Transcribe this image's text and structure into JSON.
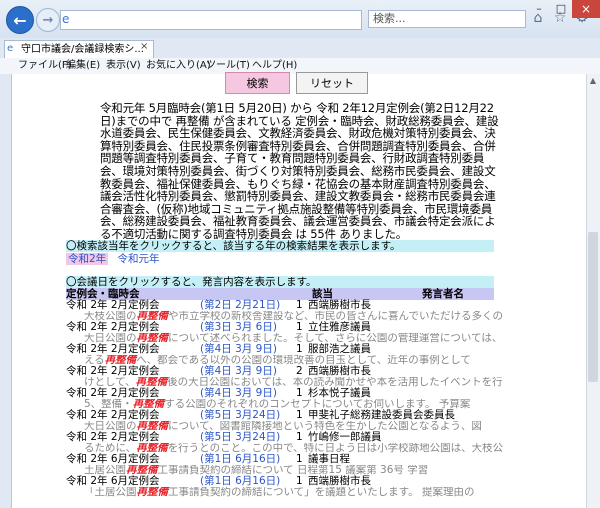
{
  "browser": {
    "address": "",
    "search_placeholder": "検索...",
    "tab_title": "守口市議会/会議録検索シ...",
    "menu": [
      "ファイル(F)",
      "編集(E)",
      "表示(V)",
      "お気に入り(A)",
      "ツール(T)",
      "ヘルプ(H)"
    ]
  },
  "toolbar": {
    "search_label": "検索",
    "reset_label": "リセット"
  },
  "summary": "令和元年 5月臨時会(第1日 5月20日) から 令和 2年12月定例会(第2日12月22日)までの中で 再整備 が含まれている 定例会・臨時会、財政総務委員会、建設水道委員会、民生保健委員会、文教経済委員会、財政危機対策特別委員会、決算特別委員会、住民投票条例審査特別委員会、合併問題調査特別委員会、合併問題等調査特別委員会、子育て・教育問題特別委員会、行財政調査特別委員会、環境対策特別委員会、街づくり対策特別委員会、総務市民委員会、建設文教委員会、福祉保健委員会、もりぐち緑・花協会の基本財産調査特別委員会、議会活性化特別委員会、懲罰特別委員会、建設文教委員会・総務市民委員会連合審査会、(仮称)地域コミュニティ拠点施設整備等特別委員会、市民環境委員会、総務建設委員会、福祉教育委員会、議会運営委員会、市議会特定会派による不適切活動に関する調査特別委員会 は 55件 ありました。",
  "hint_year": "〇検索該当年をクリックすると、該当する年の検索結果を表示します。",
  "years": {
    "selected": "令和2年",
    "other": "令和元年"
  },
  "hint_meeting": "〇会議日をクリックすると、発言内容を表示します。",
  "header": {
    "session": "定例会・臨時会",
    "date": "該当",
    "speaker": "発言者名"
  },
  "rows": [
    {
      "session": "令和 2年 2月定例会",
      "date": "(第2日 2月21日)",
      "num": "1",
      "speaker": "西端勝樹市長",
      "snip_pre": "大枝公園の",
      "snip_hl": "再整備",
      "snip_post": "や市立学校の新校舎建設など、市民の皆さんに喜んでいただける多くの"
    },
    {
      "session": "令和 2年 2月定例会",
      "date": "(第3日 3月 6日)",
      "num": "1",
      "speaker": "立住雅彦議員",
      "snip_pre": "大日公園の",
      "snip_hl": "再整備",
      "snip_post": "について述べられました。そして、さらに公園の管理運営については、"
    },
    {
      "session": "令和 2年 2月定例会",
      "date": "(第4日 3月 9日)",
      "num": "1",
      "speaker": "服部浩之議員",
      "snip_pre": "える",
      "snip_hl": "再整備",
      "snip_post": "へ、都会である以外の公園の環境改善の目玉として、近年の事例として"
    },
    {
      "session": "令和 2年 2月定例会",
      "date": "(第4日 3月 9日)",
      "num": "2",
      "speaker": "西端勝樹市長",
      "snip_pre": "けとして、",
      "snip_hl": "再整備",
      "snip_post": "後の大日公園においては、本の読み聞かせや本を活用したイベントを行"
    },
    {
      "session": "令和 2年 2月定例会",
      "date": "(第4日 3月 9日)",
      "num": "1",
      "speaker": "杉本悦子議員",
      "snip_pre": "5、整備・",
      "snip_hl": "再整備",
      "snip_post": "する公園のそれぞれのコンセプトについてお伺いします。 予算案"
    },
    {
      "session": "令和 2年 2月定例会",
      "date": "(第5日 3月24日)",
      "num": "1",
      "speaker": "甲斐礼子総務建設委員会委員長",
      "snip_pre": "大日公園の",
      "snip_hl": "再整備",
      "snip_post": "について、図書館隣接地という特色を生かした公園となるよう、図"
    },
    {
      "session": "令和 2年 2月定例会",
      "date": "(第5日 3月24日)",
      "num": "1",
      "speaker": "竹嶋修一郎議員",
      "snip_pre": "るために、",
      "snip_hl": "再整備",
      "snip_post": "を行うとのこと。この中で、特に日よう日は小学校跡地公園は、大枝公園"
    },
    {
      "session": "令和 2年 6月定例会",
      "date": "(第1日 6月16日)",
      "num": "1",
      "speaker": "議事日程",
      "snip_pre": "土居公園",
      "snip_hl": "再整備",
      "snip_post": "工事請負契約の締結について 日程第15 議案第 36号 学習"
    },
    {
      "session": "令和 2年 6月定例会",
      "date": "(第1日 6月16日)",
      "num": "1",
      "speaker": "西端勝樹市長",
      "snip_pre": "「土居公園",
      "snip_hl": "再整備",
      "snip_post": "工事請負契約の締結について」を議題といたします。 提案理由の"
    }
  ]
}
